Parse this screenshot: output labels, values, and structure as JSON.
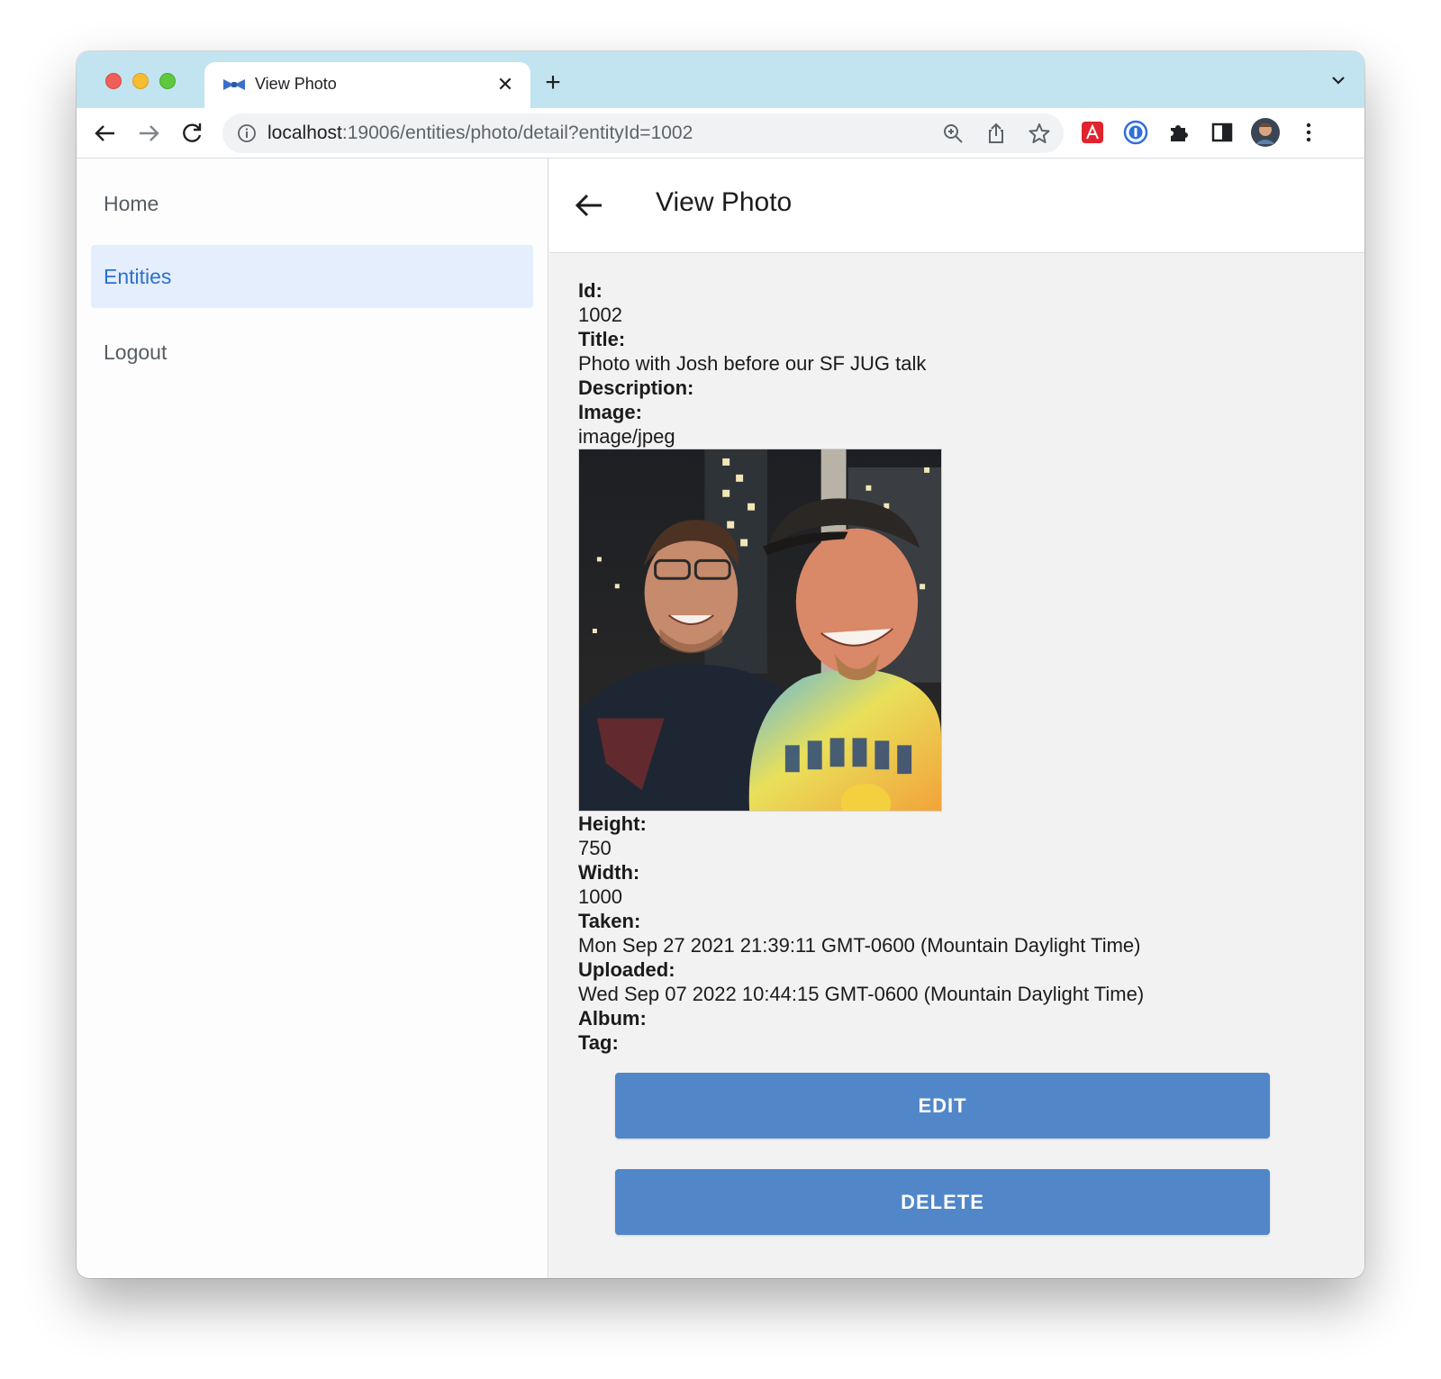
{
  "browser": {
    "tab_title": "View Photo",
    "url_host": "localhost",
    "url_path": ":19006/entities/photo/detail?entityId=1002"
  },
  "sidebar": {
    "items": [
      {
        "label": "Home"
      },
      {
        "label": "Entities"
      },
      {
        "label": "Logout"
      }
    ]
  },
  "header": {
    "title": "View Photo"
  },
  "detail": {
    "id_label": "Id:",
    "id_value": "1002",
    "title_label": "Title:",
    "title_value": "Photo with Josh before our SF JUG talk",
    "description_label": "Description:",
    "image_label": "Image:",
    "image_type": "image/jpeg",
    "height_label": "Height:",
    "height_value": "750",
    "width_label": "Width:",
    "width_value": "1000",
    "taken_label": "Taken:",
    "taken_value": "Mon Sep 27 2021 21:39:11 GMT-0600 (Mountain Daylight Time)",
    "uploaded_label": "Uploaded:",
    "uploaded_value": "Wed Sep 07 2022 10:44:15 GMT-0600 (Mountain Daylight Time)",
    "album_label": "Album:",
    "tag_label": "Tag:"
  },
  "actions": {
    "edit_label": "EDIT",
    "delete_label": "DELETE"
  },
  "colors": {
    "tabstrip": "#c1e4f0",
    "active_nav_bg": "#e4eefc",
    "active_nav_text": "#2d6fd0",
    "button": "#5187c9"
  }
}
